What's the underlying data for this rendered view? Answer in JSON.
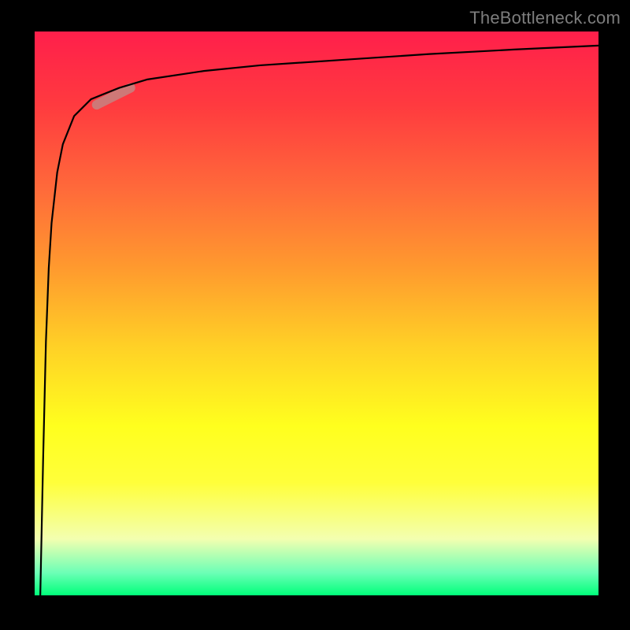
{
  "watermark": "TheBottleneck.com",
  "colors": {
    "background": "#000000",
    "gradient_top": "#ff1f4b",
    "gradient_mid": "#ffff1e",
    "gradient_bottom": "#00ff7a",
    "curve": "#000000",
    "marker": "#c97f7d"
  },
  "chart_data": {
    "type": "line",
    "title": "",
    "xlabel": "",
    "ylabel": "",
    "xlim": [
      0,
      100
    ],
    "ylim": [
      0,
      100
    ],
    "grid": false,
    "legend": false,
    "annotations": [
      {
        "type": "highlight_segment",
        "x_range": [
          11,
          17
        ],
        "y_range": [
          87,
          90
        ],
        "note": "thick pale segment on curve near top-left"
      }
    ],
    "series": [
      {
        "name": "curve",
        "x": [
          1,
          1.5,
          2,
          2.5,
          3,
          4,
          5,
          7,
          10,
          15,
          20,
          30,
          40,
          55,
          70,
          85,
          100
        ],
        "y": [
          0,
          24,
          45,
          58,
          66,
          75,
          80,
          85,
          88,
          90,
          91.5,
          93,
          94,
          95,
          96,
          96.8,
          97.5
        ]
      }
    ]
  }
}
